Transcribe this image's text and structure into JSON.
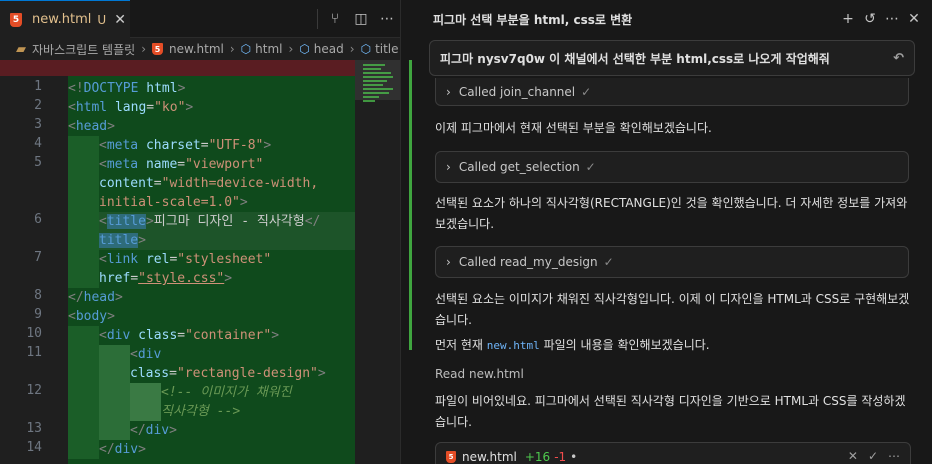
{
  "editor": {
    "tab": {
      "filename": "new.html",
      "status": "U",
      "close": "✕"
    },
    "toolbar_icons": [
      "source-control-icon",
      "split-editor-icon",
      "more-icon"
    ],
    "breadcrumb": [
      "자바스크립트 템플릿",
      "new.html",
      "html",
      "head",
      "title"
    ],
    "line_numbers": [
      "1",
      "2",
      "3",
      "4",
      "5",
      "6",
      "7",
      "8",
      "9",
      "10",
      "11",
      "12",
      "13",
      "14"
    ]
  },
  "chat": {
    "title": "피그마 선택 부분을 html, css로 변환",
    "user_message": "피그마 nysv7q0w 이 채널에서 선택한 부분 html,css로 나오게 작업해줘",
    "tool_join": "Called join_channel",
    "msg1": "이제 피그마에서 현재 선택된 부분을 확인해보겠습니다.",
    "tool_selection": "Called get_selection",
    "msg2": "선택된 요소가 하나의 직사각형(RECTANGLE)인 것을 확인했습니다. 더 자세한 정보를 가져와보겠습니다.",
    "tool_design": "Called read_my_design",
    "msg3": "선택된 요소는 이미지가 채워진 직사각형입니다. 이제 이 디자인을 HTML과 CSS로 구현해보겠습니다.",
    "msg4_before": "먼저 현재 ",
    "msg4_code": "new.html",
    "msg4_after": " 파일의 내용을 확인해보겠습니다.",
    "read_file": "Read new.html",
    "msg5": "파일이 비어있네요. 피그마에서 선택된 직사각형 디자인을 기반으로 HTML과 CSS를 작성하겠습니다.",
    "file_change": {
      "name": "new.html",
      "added": "+16",
      "removed": "-1",
      "dot": "•"
    }
  },
  "colors": {
    "added_bg": "#0f4a1c",
    "deleted_bg": "#5a1d22",
    "accent": "#0078d4"
  }
}
